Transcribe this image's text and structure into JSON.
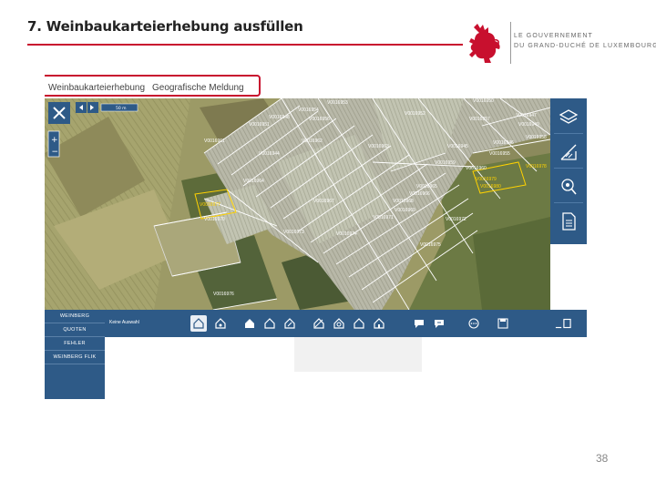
{
  "slide": {
    "title": "7. Weinbaukarteierhebung ausfüllen",
    "page_number": "38"
  },
  "logo": {
    "line1": "LE GOUVERNEMENT",
    "line2": "DU GRAND-DUCHÉ DE LUXEMBOURG"
  },
  "app": {
    "tabs": [
      "Weinbaukarteierhebung",
      "Geografische Meldung"
    ],
    "scale_label": "50 m",
    "sidebar": [
      "WEINBERG",
      "QUOTEN",
      "FEHLER",
      "WEINBERG FLIK"
    ],
    "toolbar_label": "Keine Auswahl",
    "parcel_labels": [
      "V0016953",
      "V0016954",
      "V0016948",
      "V0016951",
      "V0016956",
      "V0016952",
      "V0016950",
      "V0016957",
      "V0016947",
      "V0016949",
      "V0016958",
      "V0016961",
      "V0016962",
      "V0016963",
      "V0016944",
      "V0016945",
      "V0016946",
      "V0016955",
      "V0016959",
      "V0016960",
      "V0016964",
      "V0016965",
      "V0016966",
      "V0016967",
      "V0016968",
      "V0016969",
      "V0016970",
      "V0016971",
      "V0016972",
      "V0016973",
      "V0016974",
      "V0016975",
      "V0016976"
    ],
    "highlight_labels": [
      "V0016977",
      "V0016978",
      "V0016979",
      "V0016980"
    ],
    "colors": {
      "accent": "#c8102e",
      "app_blue": "#2e5a87",
      "parcel_outline": "#ffffff",
      "highlight_outline": "#ffd200"
    }
  },
  "icons": {
    "right_toolbar": [
      "layers-icon",
      "edit-map-icon",
      "search-location-icon",
      "document-icon"
    ],
    "bottom_toolbar": [
      "house-select-icon",
      "house-gear-icon",
      "house-add-icon",
      "house-outline-icon",
      "house-edit-icon",
      "house-split-icon",
      "house-merge-icon",
      "house-cut-icon",
      "house-simple-icon",
      "house-star-icon",
      "chat-add-icon",
      "chat-edit-icon",
      "more-icon",
      "save-icon",
      "fullscreen-icon"
    ]
  }
}
